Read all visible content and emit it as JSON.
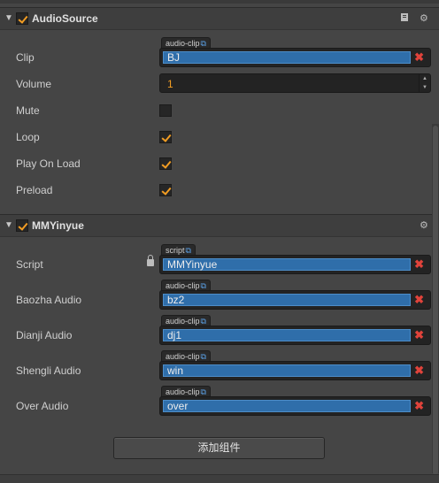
{
  "components": [
    {
      "title": "AudioSource",
      "enabled": true,
      "fields": {
        "clip": {
          "label": "Clip",
          "type_tag": "audio-clip",
          "value": "BJ"
        },
        "volume": {
          "label": "Volume",
          "value": "1"
        },
        "mute": {
          "label": "Mute",
          "checked": false
        },
        "loop": {
          "label": "Loop",
          "checked": true
        },
        "play_on_load": {
          "label": "Play On Load",
          "checked": true
        },
        "preload": {
          "label": "Preload",
          "checked": true
        }
      }
    },
    {
      "title": "MMYinyue",
      "enabled": true,
      "fields": {
        "script": {
          "label": "Script",
          "type_tag": "script",
          "value": "MMYinyue"
        },
        "baozha_audio": {
          "label": "Baozha Audio",
          "type_tag": "audio-clip",
          "value": "bz2"
        },
        "dianji_audio": {
          "label": "Dianji Audio",
          "type_tag": "audio-clip",
          "value": "dj1"
        },
        "shengli_audio": {
          "label": "Shengli Audio",
          "type_tag": "audio-clip",
          "value": "win"
        },
        "over_audio": {
          "label": "Over Audio",
          "type_tag": "audio-clip",
          "value": "over"
        }
      }
    }
  ],
  "icons": {
    "collapse": "▼",
    "link": "⧉",
    "remove": "✖",
    "settings": "⚙",
    "help": "book-icon",
    "lock": "lock-icon"
  },
  "add_component_label": "添加组件",
  "colors": {
    "accent": "#f29d23",
    "asset_field": "#2f6eaa",
    "remove": "#e0433b",
    "panel_bg": "#454545"
  }
}
